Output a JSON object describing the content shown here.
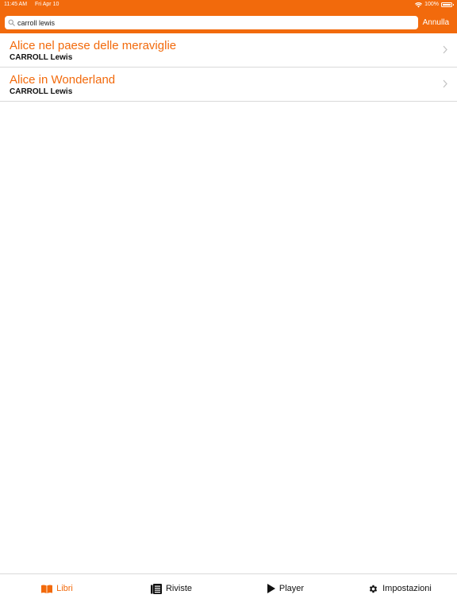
{
  "status_bar": {
    "time": "11:45 AM",
    "date": "Fri Apr 10",
    "battery": "100%"
  },
  "search": {
    "value": "carroll lewis",
    "placeholder": "",
    "cancel_label": "Annulla"
  },
  "results": [
    {
      "title": "Alice nel paese delle meraviglie",
      "author": "CARROLL Lewis"
    },
    {
      "title": "Alice in Wonderland",
      "author": "CARROLL Lewis"
    }
  ],
  "tabs": [
    {
      "label": "Libri",
      "icon": "book-icon",
      "active": true
    },
    {
      "label": "Riviste",
      "icon": "magazine-icon",
      "active": false
    },
    {
      "label": "Player",
      "icon": "play-icon",
      "active": false
    },
    {
      "label": "Impostazioni",
      "icon": "gear-icon",
      "active": false
    }
  ],
  "colors": {
    "accent": "#f26a0c",
    "separator": "#d9d9d9",
    "text": "#111111"
  }
}
